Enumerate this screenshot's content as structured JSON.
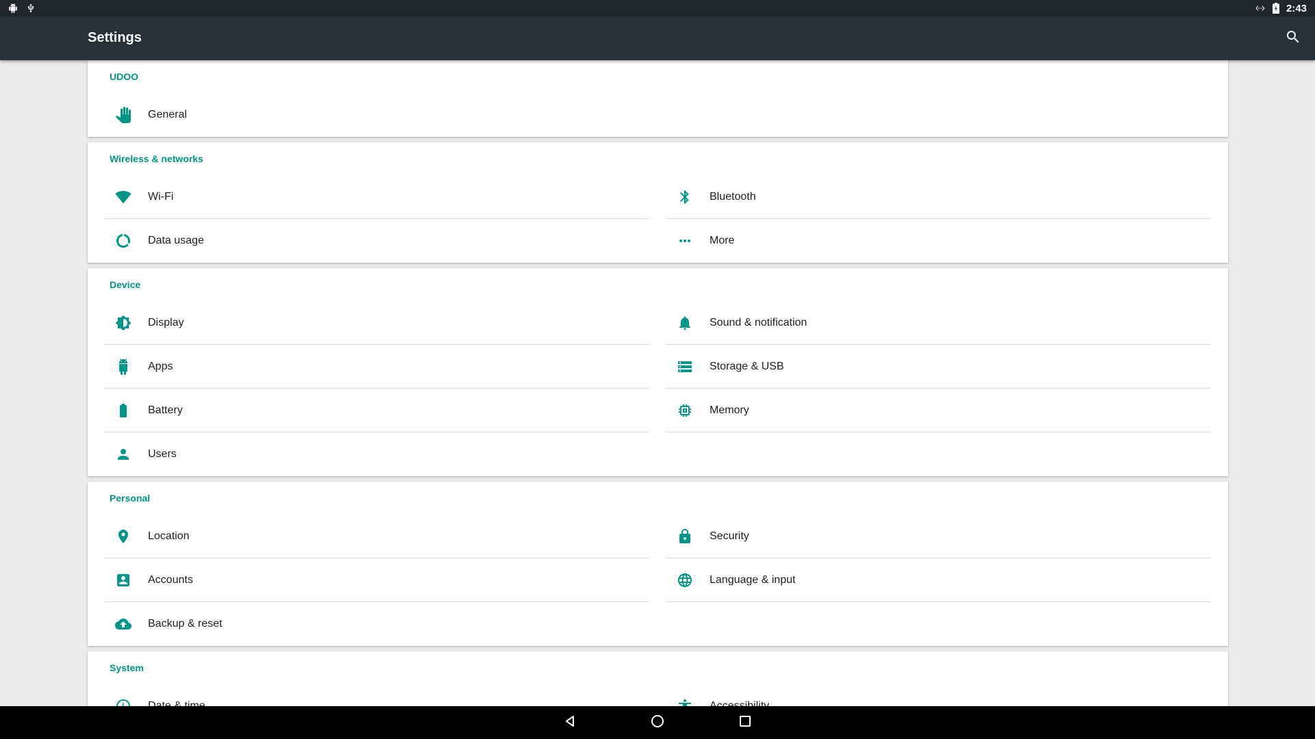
{
  "status_bar": {
    "time": "2:43",
    "left_icons": [
      "android-notification-icon",
      "usb-icon"
    ],
    "right_icons": [
      "dev-mode-icon",
      "battery-charging-icon"
    ]
  },
  "app_bar": {
    "title": "Settings",
    "search_icon": "search-icon"
  },
  "accent_color": "#009688",
  "sections": [
    {
      "title": "UDOO",
      "items": [
        {
          "label": "General",
          "icon": "hand-icon"
        }
      ]
    },
    {
      "title": "Wireless & networks",
      "items": [
        {
          "label": "Wi-Fi",
          "icon": "wifi-icon"
        },
        {
          "label": "Bluetooth",
          "icon": "bluetooth-icon"
        },
        {
          "label": "Data usage",
          "icon": "data-usage-icon"
        },
        {
          "label": "More",
          "icon": "more-icon"
        }
      ]
    },
    {
      "title": "Device",
      "items": [
        {
          "label": "Display",
          "icon": "brightness-icon"
        },
        {
          "label": "Sound & notification",
          "icon": "bell-icon"
        },
        {
          "label": "Apps",
          "icon": "android-icon"
        },
        {
          "label": "Storage & USB",
          "icon": "storage-icon"
        },
        {
          "label": "Battery",
          "icon": "battery-icon"
        },
        {
          "label": "Memory",
          "icon": "memory-icon"
        },
        {
          "label": "Users",
          "icon": "person-icon"
        }
      ]
    },
    {
      "title": "Personal",
      "items": [
        {
          "label": "Location",
          "icon": "location-icon"
        },
        {
          "label": "Security",
          "icon": "lock-icon"
        },
        {
          "label": "Accounts",
          "icon": "account-box-icon"
        },
        {
          "label": "Language & input",
          "icon": "globe-icon"
        },
        {
          "label": "Backup & reset",
          "icon": "cloud-upload-icon"
        }
      ]
    },
    {
      "title": "System",
      "items": [
        {
          "label": "Date & time",
          "icon": "clock-icon"
        },
        {
          "label": "Accessibility",
          "icon": "accessibility-icon"
        }
      ]
    }
  ],
  "nav_bar": {
    "buttons": [
      "back-icon",
      "home-icon",
      "recents-icon"
    ]
  }
}
